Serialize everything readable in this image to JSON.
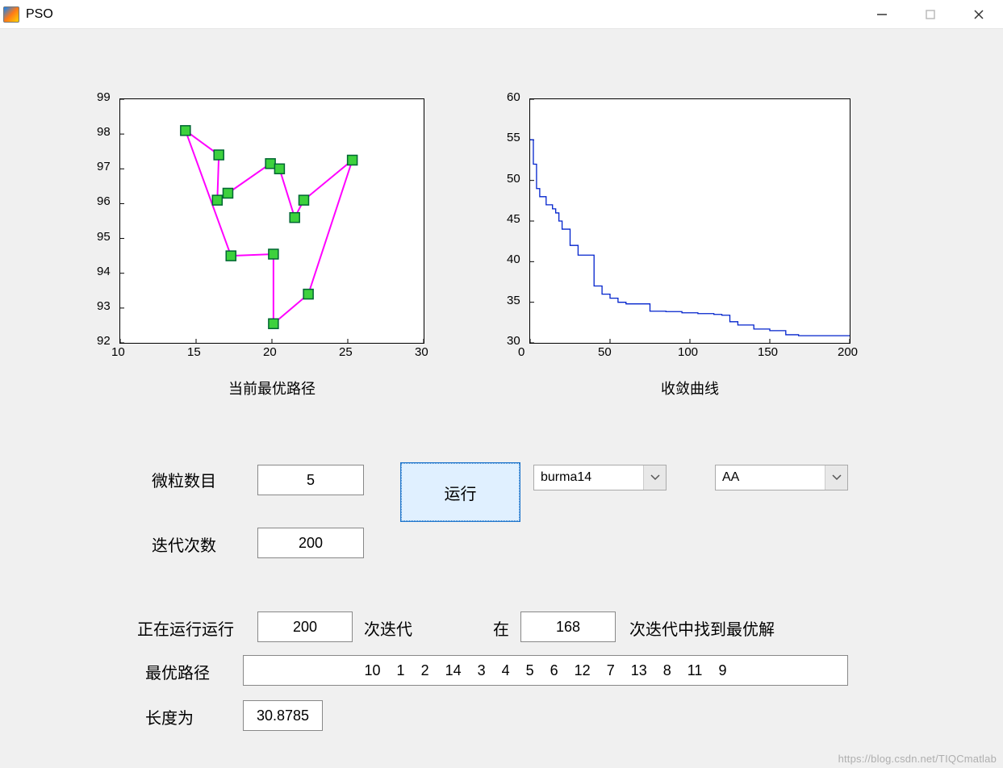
{
  "window": {
    "title": "PSO"
  },
  "chart_data": [
    {
      "type": "line",
      "title": "当前最优路径",
      "xlabel": "",
      "ylabel": "",
      "xlim": [
        10,
        30
      ],
      "ylim": [
        92,
        99
      ],
      "xticks": [
        10,
        15,
        20,
        25,
        30
      ],
      "yticks": [
        92,
        93,
        94,
        95,
        96,
        97,
        98,
        99
      ],
      "points": [
        {
          "x": 14.3,
          "y": 98.1
        },
        {
          "x": 16.5,
          "y": 97.4
        },
        {
          "x": 16.4,
          "y": 96.1
        },
        {
          "x": 17.1,
          "y": 96.3
        },
        {
          "x": 19.9,
          "y": 97.15
        },
        {
          "x": 20.5,
          "y": 97.0
        },
        {
          "x": 21.5,
          "y": 95.6
        },
        {
          "x": 22.1,
          "y": 96.1
        },
        {
          "x": 25.3,
          "y": 97.25
        },
        {
          "x": 22.4,
          "y": 93.4
        },
        {
          "x": 20.1,
          "y": 92.55
        },
        {
          "x": 20.1,
          "y": 94.55
        },
        {
          "x": 17.3,
          "y": 94.5
        },
        {
          "x": 14.3,
          "y": 98.1
        }
      ],
      "marker_color": "#3dd13d",
      "line_color": "#ff00ff"
    },
    {
      "type": "line",
      "title": "收敛曲线",
      "xlabel": "",
      "ylabel": "",
      "xlim": [
        0,
        200
      ],
      "ylim": [
        30,
        60
      ],
      "xticks": [
        0,
        50,
        100,
        150,
        200
      ],
      "yticks": [
        30,
        35,
        40,
        45,
        50,
        55,
        60
      ],
      "series": [
        {
          "name": "fitness",
          "x": [
            0,
            2,
            4,
            6,
            8,
            10,
            12,
            14,
            16,
            18,
            20,
            25,
            30,
            35,
            40,
            45,
            50,
            55,
            60,
            65,
            75,
            85,
            95,
            105,
            115,
            120,
            125,
            130,
            140,
            150,
            160,
            168,
            200
          ],
          "y": [
            55,
            52,
            49,
            48,
            48,
            47,
            47,
            46.5,
            46,
            45,
            44,
            42,
            40.8,
            40.8,
            37,
            36,
            35.5,
            35,
            34.8,
            34.8,
            33.9,
            33.85,
            33.7,
            33.6,
            33.5,
            33.4,
            32.6,
            32.2,
            31.7,
            31.5,
            31.0,
            30.88,
            30.88
          ]
        }
      ],
      "line_color": "#0022cc"
    }
  ],
  "controls": {
    "particles_label": "微粒数目",
    "particles_value": "5",
    "iters_label": "迭代次数",
    "iters_value": "200",
    "run_label": "运行",
    "dataset_value": "burma14",
    "encoding_value": "AA",
    "running_label": "正在运行运行",
    "running_value": "200",
    "running_suffix": "次迭代",
    "at_label": "在",
    "found_at_value": "168",
    "found_suffix": "次迭代中找到最优解",
    "bestpath_label": "最优路径",
    "bestpath_value": "10    1    2    14    3    4    5    6    12    7    13    8    11    9",
    "length_label": "长度为",
    "length_value": "30.8785"
  },
  "watermark": "https://blog.csdn.net/TIQCmatlab"
}
